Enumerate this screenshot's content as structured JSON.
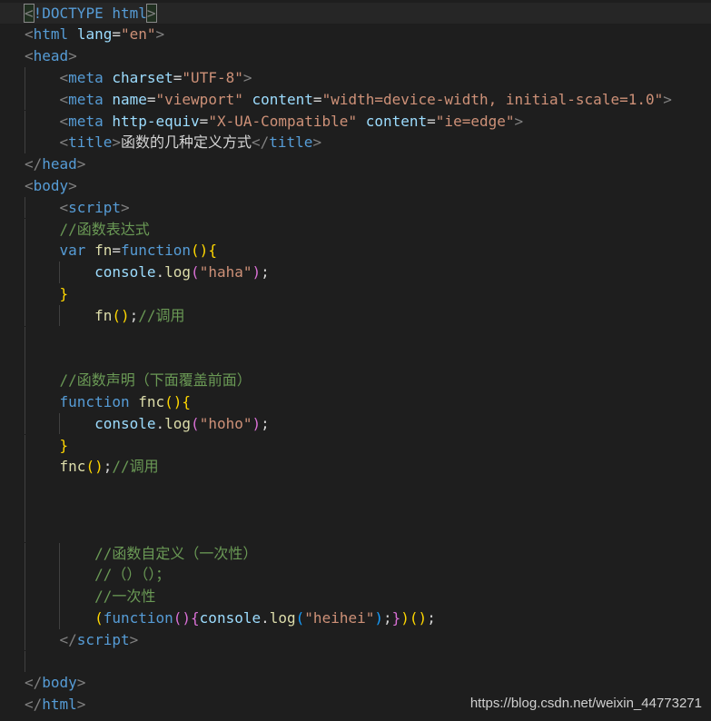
{
  "editor": {
    "lines": [
      {
        "indent": 0,
        "tokens": [
          [
            "punc",
            "<"
          ],
          [
            "tag",
            "!DOCTYPE"
          ],
          [
            "text",
            " "
          ],
          [
            "tag",
            "html"
          ],
          [
            "punc",
            ">"
          ]
        ]
      },
      {
        "indent": 0,
        "tokens": [
          [
            "punc",
            "<"
          ],
          [
            "tag",
            "html"
          ],
          [
            "text",
            " "
          ],
          [
            "attr",
            "lang"
          ],
          [
            "eq",
            "="
          ],
          [
            "str",
            "\"en\""
          ],
          [
            "punc",
            ">"
          ]
        ]
      },
      {
        "indent": 0,
        "tokens": [
          [
            "punc",
            "<"
          ],
          [
            "tag",
            "head"
          ],
          [
            "punc",
            ">"
          ]
        ]
      },
      {
        "indent": 1,
        "tokens": [
          [
            "text",
            "    "
          ],
          [
            "punc",
            "<"
          ],
          [
            "tag",
            "meta"
          ],
          [
            "text",
            " "
          ],
          [
            "attr",
            "charset"
          ],
          [
            "eq",
            "="
          ],
          [
            "str",
            "\"UTF-8\""
          ],
          [
            "punc",
            ">"
          ]
        ]
      },
      {
        "indent": 1,
        "tokens": [
          [
            "text",
            "    "
          ],
          [
            "punc",
            "<"
          ],
          [
            "tag",
            "meta"
          ],
          [
            "text",
            " "
          ],
          [
            "attr",
            "name"
          ],
          [
            "eq",
            "="
          ],
          [
            "str",
            "\"viewport\""
          ],
          [
            "text",
            " "
          ],
          [
            "attr",
            "content"
          ],
          [
            "eq",
            "="
          ],
          [
            "str",
            "\"width=device-width, initial-scale=1.0\""
          ],
          [
            "punc",
            ">"
          ]
        ]
      },
      {
        "indent": 1,
        "tokens": [
          [
            "text",
            "    "
          ],
          [
            "punc",
            "<"
          ],
          [
            "tag",
            "meta"
          ],
          [
            "text",
            " "
          ],
          [
            "attr",
            "http-equiv"
          ],
          [
            "eq",
            "="
          ],
          [
            "str",
            "\"X-UA-Compatible\""
          ],
          [
            "text",
            " "
          ],
          [
            "attr",
            "content"
          ],
          [
            "eq",
            "="
          ],
          [
            "str",
            "\"ie=edge\""
          ],
          [
            "punc",
            ">"
          ]
        ]
      },
      {
        "indent": 1,
        "tokens": [
          [
            "text",
            "    "
          ],
          [
            "punc",
            "<"
          ],
          [
            "tag",
            "title"
          ],
          [
            "punc",
            ">"
          ],
          [
            "text",
            "函数的几种定义方式"
          ],
          [
            "punc",
            "</"
          ],
          [
            "tag",
            "title"
          ],
          [
            "punc",
            ">"
          ]
        ]
      },
      {
        "indent": 0,
        "tokens": [
          [
            "punc",
            "</"
          ],
          [
            "tag",
            "head"
          ],
          [
            "punc",
            ">"
          ]
        ]
      },
      {
        "indent": 0,
        "tokens": [
          [
            "punc",
            "<"
          ],
          [
            "tag",
            "body"
          ],
          [
            "punc",
            ">"
          ]
        ]
      },
      {
        "indent": 1,
        "tokens": [
          [
            "text",
            "    "
          ],
          [
            "punc",
            "<"
          ],
          [
            "tag",
            "script"
          ],
          [
            "punc",
            ">"
          ]
        ]
      },
      {
        "indent": 1,
        "tokens": [
          [
            "text",
            "    "
          ],
          [
            "com",
            "//函数表达式"
          ]
        ]
      },
      {
        "indent": 1,
        "tokens": [
          [
            "text",
            "    "
          ],
          [
            "kw",
            "var"
          ],
          [
            "text",
            " "
          ],
          [
            "fn",
            "fn"
          ],
          [
            "eq",
            "="
          ],
          [
            "kw",
            "function"
          ],
          [
            "p1",
            "()"
          ],
          [
            "p1",
            "{"
          ]
        ]
      },
      {
        "indent": 2,
        "tokens": [
          [
            "text",
            "        "
          ],
          [
            "id",
            "console"
          ],
          [
            "text",
            "."
          ],
          [
            "fn",
            "log"
          ],
          [
            "p2",
            "("
          ],
          [
            "str",
            "\"haha\""
          ],
          [
            "p2",
            ")"
          ],
          [
            "text",
            ";"
          ]
        ]
      },
      {
        "indent": 1,
        "tokens": [
          [
            "text",
            "    "
          ],
          [
            "p1",
            "}"
          ]
        ]
      },
      {
        "indent": 2,
        "tokens": [
          [
            "text",
            "        "
          ],
          [
            "fn",
            "fn"
          ],
          [
            "p1",
            "()"
          ],
          [
            "text",
            ";"
          ],
          [
            "com",
            "//调用"
          ]
        ]
      },
      {
        "indent": 1,
        "tokens": []
      },
      {
        "indent": 1,
        "tokens": []
      },
      {
        "indent": 1,
        "tokens": [
          [
            "text",
            "    "
          ],
          [
            "com",
            "//函数声明（下面覆盖前面）"
          ]
        ]
      },
      {
        "indent": 1,
        "tokens": [
          [
            "text",
            "    "
          ],
          [
            "kw",
            "function"
          ],
          [
            "text",
            " "
          ],
          [
            "fn",
            "fnc"
          ],
          [
            "p1",
            "()"
          ],
          [
            "p1",
            "{"
          ]
        ]
      },
      {
        "indent": 2,
        "tokens": [
          [
            "text",
            "        "
          ],
          [
            "id",
            "console"
          ],
          [
            "text",
            "."
          ],
          [
            "fn",
            "log"
          ],
          [
            "p2",
            "("
          ],
          [
            "str",
            "\"hoho\""
          ],
          [
            "p2",
            ")"
          ],
          [
            "text",
            ";"
          ]
        ]
      },
      {
        "indent": 1,
        "tokens": [
          [
            "text",
            "    "
          ],
          [
            "p1",
            "}"
          ]
        ]
      },
      {
        "indent": 1,
        "tokens": [
          [
            "text",
            "    "
          ],
          [
            "fn",
            "fnc"
          ],
          [
            "p1",
            "()"
          ],
          [
            "text",
            ";"
          ],
          [
            "com",
            "//调用"
          ]
        ]
      },
      {
        "indent": 1,
        "tokens": []
      },
      {
        "indent": 1,
        "tokens": []
      },
      {
        "indent": 1,
        "tokens": []
      },
      {
        "indent": 2,
        "tokens": [
          [
            "text",
            "        "
          ],
          [
            "com",
            "//函数自定义（一次性）"
          ]
        ]
      },
      {
        "indent": 2,
        "tokens": [
          [
            "text",
            "        "
          ],
          [
            "com",
            "//（）（）；"
          ]
        ]
      },
      {
        "indent": 2,
        "tokens": [
          [
            "text",
            "        "
          ],
          [
            "com",
            "//一次性"
          ]
        ]
      },
      {
        "indent": 2,
        "tokens": [
          [
            "text",
            "        "
          ],
          [
            "p1",
            "("
          ],
          [
            "kw",
            "function"
          ],
          [
            "p2",
            "()"
          ],
          [
            "p2",
            "{"
          ],
          [
            "id",
            "console"
          ],
          [
            "text",
            "."
          ],
          [
            "fn",
            "log"
          ],
          [
            "p3",
            "("
          ],
          [
            "str",
            "\"heihei\""
          ],
          [
            "p3",
            ")"
          ],
          [
            "text",
            ";"
          ],
          [
            "p2",
            "}"
          ],
          [
            "p1",
            ")"
          ],
          [
            "p1",
            "()"
          ],
          [
            "text",
            ";"
          ]
        ]
      },
      {
        "indent": 1,
        "tokens": [
          [
            "text",
            "    "
          ],
          [
            "punc",
            "</"
          ],
          [
            "tag",
            "script"
          ],
          [
            "punc",
            ">"
          ]
        ]
      },
      {
        "indent": 1,
        "tokens": []
      },
      {
        "indent": 0,
        "tokens": [
          [
            "punc",
            "</"
          ],
          [
            "tag",
            "body"
          ],
          [
            "punc",
            ">"
          ]
        ]
      },
      {
        "indent": 0,
        "tokens": [
          [
            "punc",
            "</"
          ],
          [
            "tag",
            "html"
          ],
          [
            "punc",
            ">"
          ]
        ]
      }
    ]
  },
  "watermark": "https://blog.csdn.net/weixin_44773271"
}
